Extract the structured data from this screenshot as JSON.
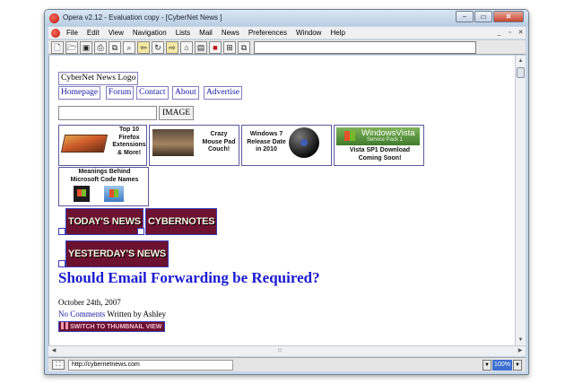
{
  "window": {
    "title": "Opera v2.12 - Evaluation copy - [CyberNet News ]",
    "controls": {
      "minimize": "−",
      "maximize": "▭",
      "close": "✕"
    },
    "mdi_controls": {
      "minimize": "_",
      "restore": "▫",
      "close": "✕"
    }
  },
  "menu": {
    "items": [
      "File",
      "Edit",
      "View",
      "Navigation",
      "Lists",
      "Mail",
      "News",
      "Preferences",
      "Window",
      "Help"
    ]
  },
  "toolbar": {
    "buttons": [
      {
        "icon": "new-page-icon",
        "glyph": "🗋"
      },
      {
        "icon": "open-icon",
        "glyph": "🗁"
      },
      {
        "icon": "save-icon",
        "glyph": "▣"
      },
      {
        "icon": "print-icon",
        "glyph": "⎙"
      },
      {
        "icon": "copy-icon",
        "glyph": "⧉"
      },
      {
        "icon": "find-icon",
        "glyph": "⌕"
      },
      {
        "icon": "back-arrow-icon",
        "glyph": "⇦"
      },
      {
        "icon": "reload-icon",
        "glyph": "↻"
      },
      {
        "icon": "forward-arrow-icon",
        "glyph": "⇨"
      },
      {
        "icon": "home-icon",
        "glyph": "⌂"
      },
      {
        "icon": "images-icon",
        "glyph": "▤"
      },
      {
        "icon": "hotlist-icon",
        "glyph": "■"
      },
      {
        "icon": "tile-windows-icon",
        "glyph": "⊞"
      },
      {
        "icon": "cascade-windows-icon",
        "glyph": "⧉"
      }
    ]
  },
  "page": {
    "logo_alt": "CyberNet News Logo",
    "nav": [
      "Homepage",
      "Forum",
      "Contact",
      "About",
      "Advertise"
    ],
    "search_button": "IMAGE",
    "thumbnails": [
      {
        "caption": "Top 10\nFirefox\nExtensions\n& More!"
      },
      {
        "caption": "Crazy\nMouse Pad\nCouch!"
      },
      {
        "caption": "Windows 7\nRelease Date\nin 2010"
      },
      {
        "caption": "Vista SP1 Download\nComing Soon!",
        "banner_title": "WindowsVista",
        "banner_subtitle": "Service Pack 1"
      },
      {
        "caption": "Meanings Behind\nMicrosoft Code Names"
      }
    ],
    "section_buttons": [
      "Today's News",
      "Cybernotes",
      "Yesterday's News"
    ],
    "headline": "Should Email Forwarding be Required?",
    "date": "October 24th, 2007",
    "comments_link": "No Comments",
    "author": "Written by Ashley",
    "switch_view": "Switch To Thumbnail View"
  },
  "scrollbar": {
    "grip": "⦙⦙⦙"
  },
  "status": {
    "url": "http://cybernetnews.com",
    "zoom": "100%"
  }
}
